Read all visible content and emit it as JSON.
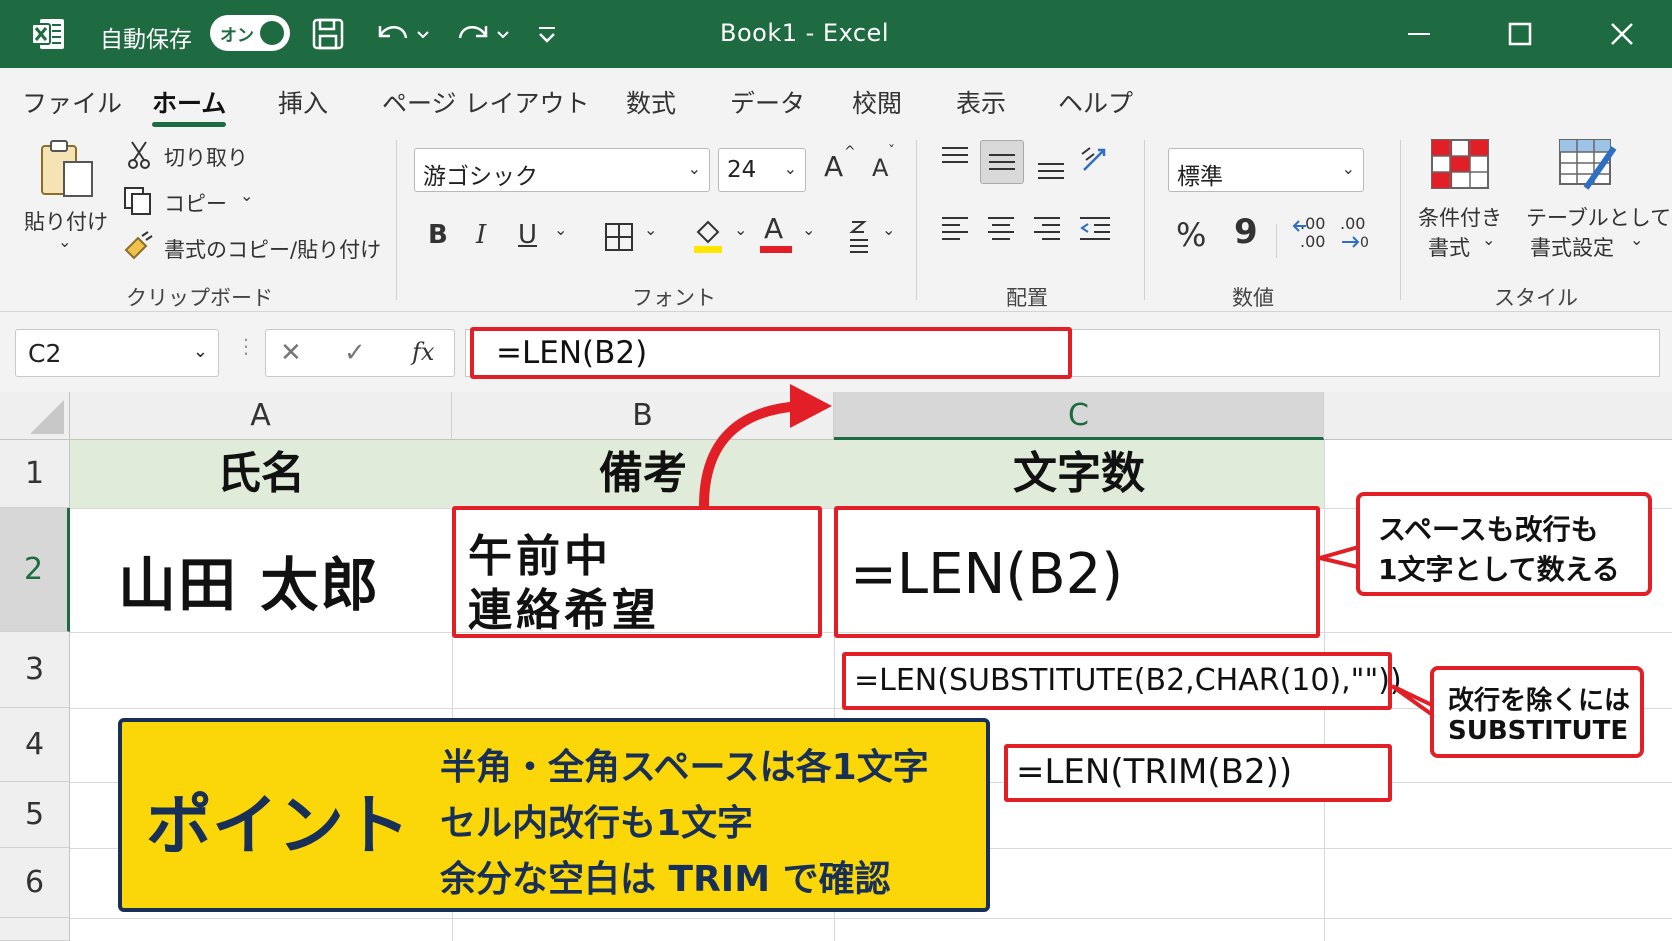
{
  "colors": {
    "excel_green": "#1e6b41",
    "highlight_red": "#e21f26",
    "point_yellow": "#fbd70a",
    "point_border": "#183058",
    "header_fill": "#e0ecd9"
  },
  "titlebar": {
    "autosave_label": "自動保存",
    "autosave_toggle": "オン",
    "title": "Book1  -  Excel",
    "icons": [
      "excel-logo-icon",
      "save-icon",
      "undo-icon",
      "redo-icon",
      "customize-icon",
      "minimize-icon",
      "maximize-icon",
      "close-icon"
    ]
  },
  "tabs": [
    {
      "label": "ファイル"
    },
    {
      "label": "ホーム",
      "active": true
    },
    {
      "label": "挿入"
    },
    {
      "label": "ページ レイアウト"
    },
    {
      "label": "数式"
    },
    {
      "label": "データ"
    },
    {
      "label": "校閲"
    },
    {
      "label": "表示"
    },
    {
      "label": "ヘルプ"
    }
  ],
  "ribbon": {
    "clipboard": {
      "paste": "貼り付け",
      "cut": "切り取り",
      "copy": "コピー",
      "format_painter": "書式のコピー/貼り付け",
      "group": "クリップボード"
    },
    "font": {
      "font_name": "游ゴシック",
      "font_size": "24",
      "grow": "A",
      "shrink": "A",
      "bold": "B",
      "italic": "I",
      "underline": "U",
      "font_color": "A",
      "group": "フォント"
    },
    "alignment": {
      "group": "配置"
    },
    "number": {
      "format": "標準",
      "percent": "%",
      "comma": "9",
      "inc_decimal": ".00",
      "dec_decimal": ".00",
      "group": "数値"
    },
    "styles": {
      "conditional_1": "条件付き",
      "conditional_2": "書式",
      "table_1": "テーブルとして",
      "table_2": "書式設定",
      "group": "スタイル"
    }
  },
  "formula_bar": {
    "name_box": "C2",
    "cancel": "✕",
    "enter": "✓",
    "fx": "fx",
    "formula": "=LEN(B2)"
  },
  "sheet": {
    "columns": [
      "A",
      "B",
      "C"
    ],
    "rows": [
      "1",
      "2",
      "3",
      "4",
      "5",
      "6"
    ],
    "headers": [
      "氏名",
      "備考",
      "文字数"
    ],
    "a2": "山田 太郎",
    "b2_line1": "午前中",
    "b2_line2": "連絡希望",
    "c2": "=LEN(B2)",
    "c3": "=LEN(SUBSTITUTE(B2,CHAR(10),\"\"))",
    "c4": "=LEN(TRIM(B2))"
  },
  "callouts": {
    "spaces_line1": "スペースも改行も",
    "spaces_line2": "1文字として数える",
    "remove_line1": "改行を除くには",
    "remove_line2": "SUBSTITUTE"
  },
  "point": {
    "title": "ポイント",
    "line1": "半角・全角スペースは各1文字",
    "line2": "セル内改行も1文字",
    "line3": "余分な空白は TRIM で確認"
  }
}
